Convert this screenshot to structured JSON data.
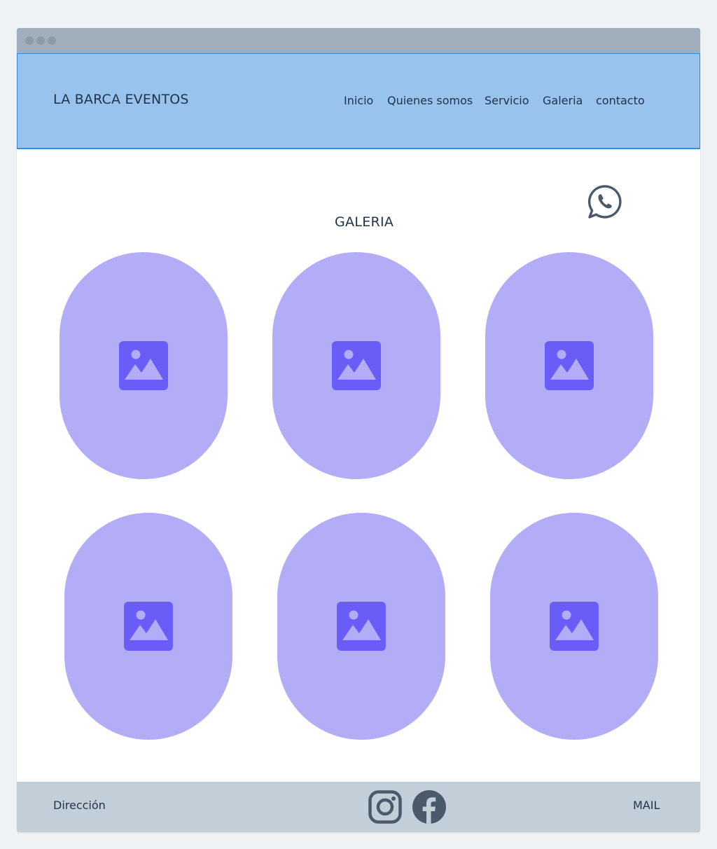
{
  "header": {
    "brand": "LA BARCA EVENTOS",
    "nav": [
      {
        "label": "Inicio"
      },
      {
        "label": "Quienes somos"
      },
      {
        "label": "Servicio"
      },
      {
        "label": "Galeria"
      },
      {
        "label": "contacto"
      }
    ]
  },
  "main": {
    "title": "GALERIA",
    "whatsapp_icon": "whatsapp-icon",
    "gallery": [
      {
        "icon": "image-placeholder-icon"
      },
      {
        "icon": "image-placeholder-icon"
      },
      {
        "icon": "image-placeholder-icon"
      },
      {
        "icon": "image-placeholder-icon"
      },
      {
        "icon": "image-placeholder-icon"
      },
      {
        "icon": "image-placeholder-icon"
      }
    ]
  },
  "footer": {
    "address": "Dirección",
    "mail": "MAIL",
    "social": [
      {
        "icon": "instagram-icon"
      },
      {
        "icon": "facebook-icon"
      }
    ]
  },
  "colors": {
    "header_bg": "#97c3ec",
    "tile_bg": "#b3adf8",
    "tile_icon": "#6a5df7",
    "footer_bg": "#c2cfd9",
    "text": "#22334a",
    "icon_dark": "#4a5a6a"
  }
}
